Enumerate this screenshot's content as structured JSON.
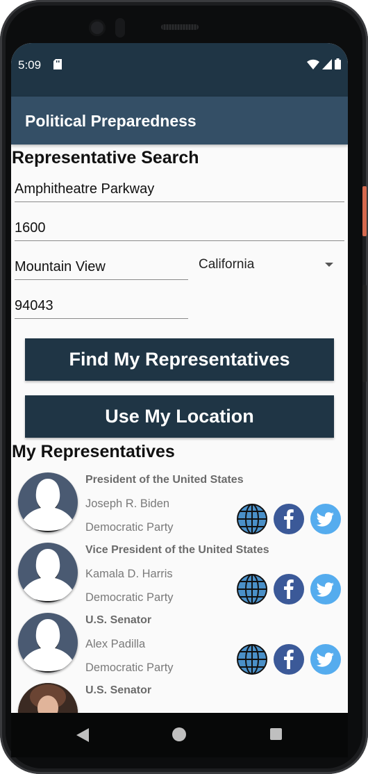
{
  "status_bar": {
    "time": "5:09"
  },
  "app_bar": {
    "title": "Political Preparedness"
  },
  "search": {
    "heading": "Representative Search",
    "address_line1": "Amphitheatre Parkway",
    "address_line2": "1600",
    "city": "Mountain View",
    "state": "California",
    "zip": "94043"
  },
  "buttons": {
    "find": "Find My Representatives",
    "location": "Use My Location"
  },
  "representatives": {
    "heading": "My Representatives",
    "items": [
      {
        "office": "President of the United States",
        "name": "Joseph R. Biden",
        "party": "Democratic Party"
      },
      {
        "office": "Vice President of the United States",
        "name": "Kamala D. Harris",
        "party": "Democratic Party"
      },
      {
        "office": "U.S. Senator",
        "name": "Alex Padilla",
        "party": "Democratic Party"
      },
      {
        "office": "U.S. Senator"
      }
    ]
  },
  "icons": [
    "web-globe-icon",
    "facebook-icon",
    "twitter-icon",
    "sd-card-icon",
    "wifi-icon",
    "cell-signal-icon",
    "battery-icon",
    "back-icon",
    "home-icon",
    "recents-icon"
  ],
  "colors": {
    "primary_dark": "#1f3545",
    "app_bar": "#344f66",
    "facebook": "#3b5998",
    "twitter": "#55acee"
  }
}
